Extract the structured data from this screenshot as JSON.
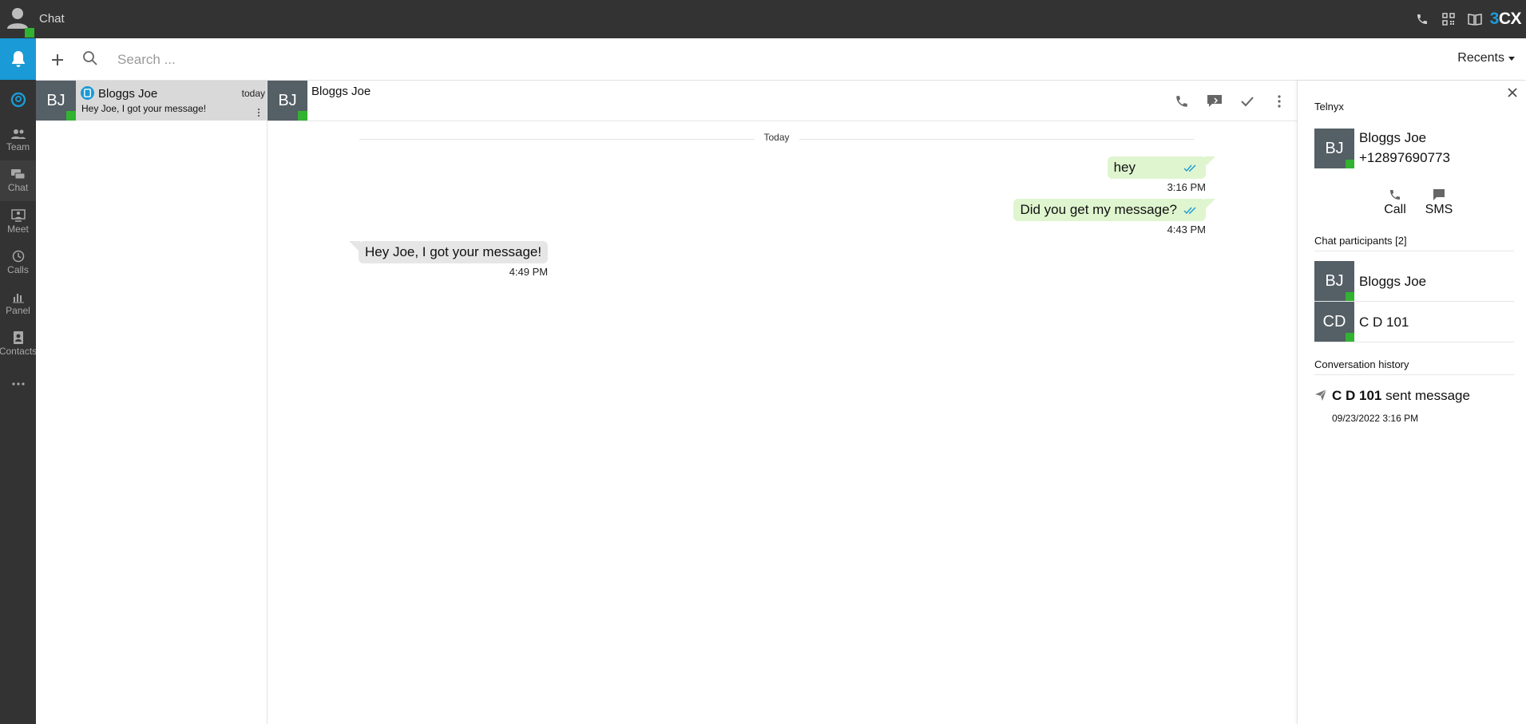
{
  "app": {
    "title": "Chat"
  },
  "brand": {
    "three": "3",
    "cx": "CX"
  },
  "nav": {
    "items": [
      {
        "label": "Team"
      },
      {
        "label": "Chat"
      },
      {
        "label": "Meet"
      },
      {
        "label": "Calls"
      },
      {
        "label": "Panel"
      },
      {
        "label": "Contacts"
      }
    ]
  },
  "search": {
    "placeholder": "Search ...",
    "value": ""
  },
  "recents": {
    "label": "Recents"
  },
  "conversations": [
    {
      "initials": "BJ",
      "name": "Bloggs Joe",
      "time": "today",
      "preview": "Hey Joe, I got your message!"
    }
  ],
  "chat": {
    "title": "Bloggs Joe",
    "initials": "BJ",
    "date_separator": "Today",
    "messages": [
      {
        "direction": "out",
        "text": "hey",
        "time": "3:16 PM"
      },
      {
        "direction": "out",
        "text": "Did you get my message?",
        "time": "4:43 PM"
      },
      {
        "direction": "in",
        "text": "Hey Joe, I got your message!",
        "time": "4:49 PM"
      }
    ]
  },
  "info": {
    "provider": "Telnyx",
    "contact": {
      "initials": "BJ",
      "name": "Bloggs Joe",
      "phone": "+12897690773"
    },
    "actions": {
      "call": "Call",
      "sms": "SMS"
    },
    "participants_title": "Chat participants [2]",
    "participants": [
      {
        "initials": "BJ",
        "name": "Bloggs Joe"
      },
      {
        "initials": "CD",
        "name": "C D 101"
      }
    ],
    "history_title": "Conversation history",
    "history": [
      {
        "actor": "C D 101",
        "action": "sent message",
        "date": "09/23/2022 3:16 PM"
      }
    ]
  },
  "colors": {
    "topbar": "#333333",
    "accent": "#1a9ad6",
    "presence": "#31b331",
    "avatar": "#545f66",
    "bubble_out": "#dff5cf",
    "bubble_in": "#e6e6e6",
    "read_check": "#1a9ad6"
  }
}
